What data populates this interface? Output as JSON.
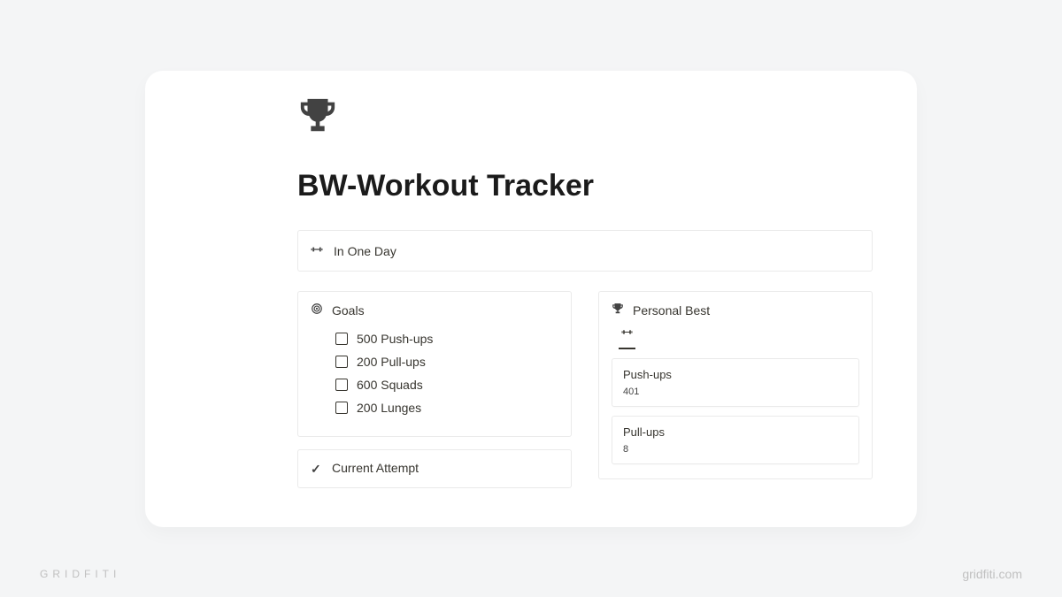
{
  "page": {
    "title": "BW-Workout Tracker"
  },
  "callout": {
    "text": "In One Day"
  },
  "goals": {
    "header": "Goals",
    "items": [
      {
        "label": "500 Push-ups"
      },
      {
        "label": "200 Pull-ups"
      },
      {
        "label": "600 Squads"
      },
      {
        "label": "200 Lunges"
      }
    ]
  },
  "current_attempt": {
    "header": "Current Attempt"
  },
  "personal_best": {
    "header": "Personal Best",
    "records": [
      {
        "exercise": "Push-ups",
        "value": "401"
      },
      {
        "exercise": "Pull-ups",
        "value": "8"
      }
    ]
  },
  "footer": {
    "brand": "GRIDFITI",
    "site": "gridfiti.com"
  }
}
